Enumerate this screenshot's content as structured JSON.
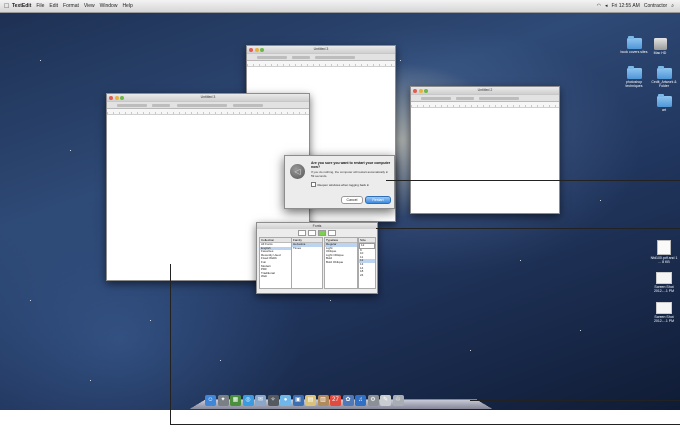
{
  "menubar": {
    "apple": "",
    "app": "TextEdit",
    "items": [
      "File",
      "Edit",
      "Format",
      "View",
      "Window",
      "Help"
    ],
    "clock": "Fri 12:55 AM",
    "user": "Contractor"
  },
  "windows": {
    "back": "Untitled 3",
    "left": "Untitled 3",
    "right": "Untitled 2"
  },
  "dialog": {
    "title": "Are you sure you want to restart your computer now?",
    "body": "If you do nothing, the computer will restart automatically in 59 seconds.",
    "checkbox": "Reopen windows when logging back in",
    "cancel": "Cancel",
    "restart": "Restart"
  },
  "font_panel": {
    "title": "Fonts",
    "collections_header": "Collection",
    "collections": [
      "All Fonts",
      "English",
      "Favorites",
      "Recently Used",
      "Fixed Width",
      "Fun",
      "Modern",
      "PDF",
      "Traditional",
      "Web"
    ],
    "family_header": "Family",
    "families": [
      "Helvetica",
      "Times"
    ],
    "typeface_header": "Typeface",
    "typefaces": [
      "Regular",
      "Light",
      "Oblique",
      "Light Oblique",
      "Bold",
      "Bold Oblique"
    ],
    "size_header": "Size",
    "size_value": "12",
    "sizes": [
      "9",
      "10",
      "11",
      "12",
      "13",
      "14",
      "18",
      "24"
    ]
  },
  "desktop_icons": [
    {
      "label": "Mac HD",
      "kind": "hdd"
    },
    {
      "label": "book covers sites",
      "kind": "folder"
    },
    {
      "label": "Cedit_Artwork & Folder",
      "kind": "folder"
    },
    {
      "label": "photoshop techniques",
      "kind": "folder"
    },
    {
      "label": "art",
      "kind": "folder"
    },
    {
      "label": "Nfd100.pdf and 1 ... 8 KB",
      "kind": "doc"
    },
    {
      "label": "Screen Shot 2012-...1 PM",
      "kind": "shot"
    },
    {
      "label": "Screen Shot 2012-...1 PM",
      "kind": "shot"
    }
  ],
  "dock": {
    "icons": [
      {
        "name": "finder-icon",
        "color": "#3f86d8",
        "glyph": "☺"
      },
      {
        "name": "launchpad-icon",
        "color": "#7a7f86",
        "glyph": "✦"
      },
      {
        "name": "mission-control-icon",
        "color": "#4b8f3c",
        "glyph": "▦"
      },
      {
        "name": "safari-icon",
        "color": "#3b9be0",
        "glyph": "◎"
      },
      {
        "name": "mail-icon",
        "color": "#8aa6c8",
        "glyph": "✉"
      },
      {
        "name": "compass-icon",
        "color": "#555a60",
        "glyph": "✧"
      },
      {
        "name": "messages-icon",
        "color": "#6fb7ea",
        "glyph": "●"
      },
      {
        "name": "preview-icon",
        "color": "#3c6fb2",
        "glyph": "▣"
      },
      {
        "name": "notes-icon",
        "color": "#d9c27a",
        "glyph": "▤"
      },
      {
        "name": "address-book-icon",
        "color": "#b08a5b",
        "glyph": "▥"
      },
      {
        "name": "calendar-icon",
        "color": "#e04a3f",
        "glyph": "27"
      },
      {
        "name": "photos-icon",
        "color": "#4f78b8",
        "glyph": "✿"
      },
      {
        "name": "itunes-icon",
        "color": "#2f6fc4",
        "glyph": "♫"
      },
      {
        "name": "system-prefs-icon",
        "color": "#8b8f96",
        "glyph": "⚙"
      },
      {
        "name": "textedit-icon",
        "color": "#c9cdd2",
        "glyph": "✎"
      },
      {
        "name": "trash-icon",
        "color": "#a8adb4",
        "glyph": "♲"
      }
    ]
  }
}
